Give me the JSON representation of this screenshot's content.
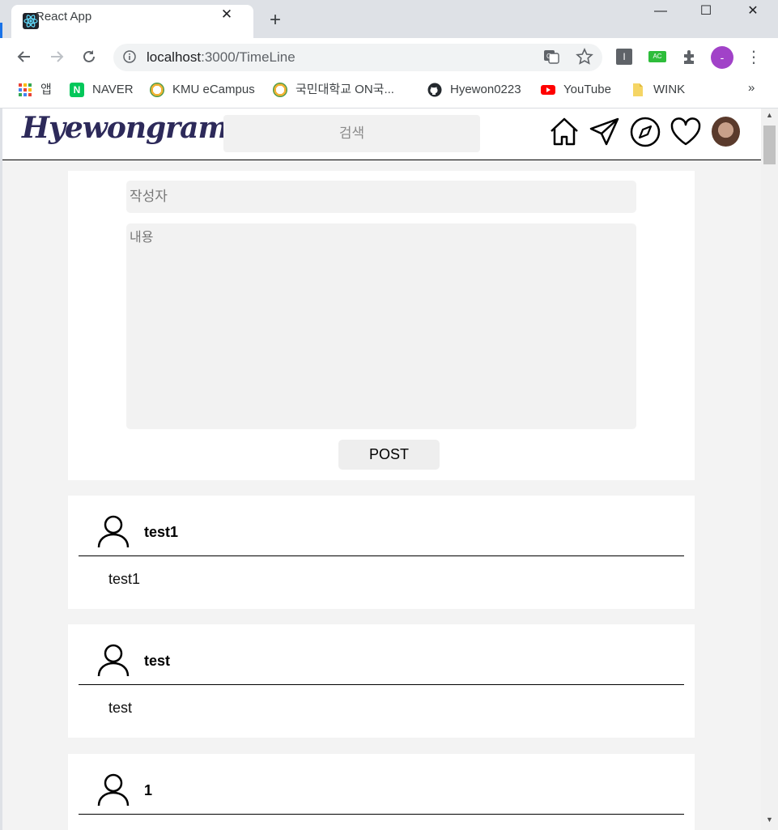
{
  "browser": {
    "tab_title": "React App",
    "new_tab_label": "+",
    "url_host": "localhost",
    "url_rest": ":3000/TimeLine",
    "profile_initial": "-",
    "ext_badge": "AC",
    "more_label": "»"
  },
  "bookmarks": [
    {
      "label": "앱",
      "icon": "apps-icon"
    },
    {
      "label": "NAVER",
      "icon": "naver-icon",
      "color": "#03c75a"
    },
    {
      "label": "KMU eCampus",
      "icon": "kmu-ecampus-icon"
    },
    {
      "label": "국민대학교 ON국...",
      "icon": "kmu-on-icon"
    },
    {
      "label": "Hyewon0223",
      "icon": "github-icon"
    },
    {
      "label": "YouTube",
      "icon": "youtube-icon",
      "color": "#ff0000"
    },
    {
      "label": "WINK",
      "icon": "folder-icon",
      "color": "#f5d565"
    }
  ],
  "site": {
    "logo": "Hyewongram",
    "search_placeholder": "검색",
    "nav_icons": [
      "home-icon",
      "send-icon",
      "explore-icon",
      "heart-icon",
      "profile-avatar"
    ]
  },
  "composer": {
    "author_placeholder": "작성자",
    "content_placeholder": "내용",
    "post_label": "POST"
  },
  "posts": [
    {
      "author": "test1",
      "body": "test1"
    },
    {
      "author": "test",
      "body": "test"
    },
    {
      "author": "1",
      "body": ""
    }
  ]
}
